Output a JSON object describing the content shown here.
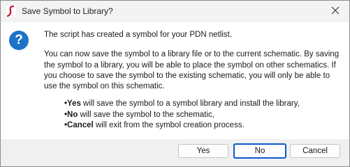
{
  "window": {
    "title": "Save Symbol to Library?",
    "app_icon": "ltspice-icon",
    "close_icon": "close-icon"
  },
  "dialog": {
    "icon": "question-icon",
    "icon_glyph": "?",
    "line1": "The script has created a symbol for your PDN netlist.",
    "paragraph2": "You can now save the symbol to a library file or to the current schematic. By saving the symbol to a library, you will be able to place the symbol on other schematics. If you choose to save the symbol to the existing schematic, you will only be able to use the symbol on this schematic.",
    "bullets": [
      {
        "keyword": "Yes",
        "text": " will save the symbol to a symbol library and install the library,"
      },
      {
        "keyword": "No",
        "text": " will save the symbol to the schematic,"
      },
      {
        "keyword": "Cancel",
        "text": " will exit from the symbol creation process."
      }
    ]
  },
  "buttons": {
    "yes": "Yes",
    "no": "No",
    "cancel": "Cancel",
    "default": "no"
  },
  "colors": {
    "accent": "#0b57d0",
    "icon_blue": "#1e72c8",
    "footer_bg": "#f0f0f0",
    "titlebar_bg": "#f3f3f3",
    "app_icon_red": "#c8102e"
  }
}
